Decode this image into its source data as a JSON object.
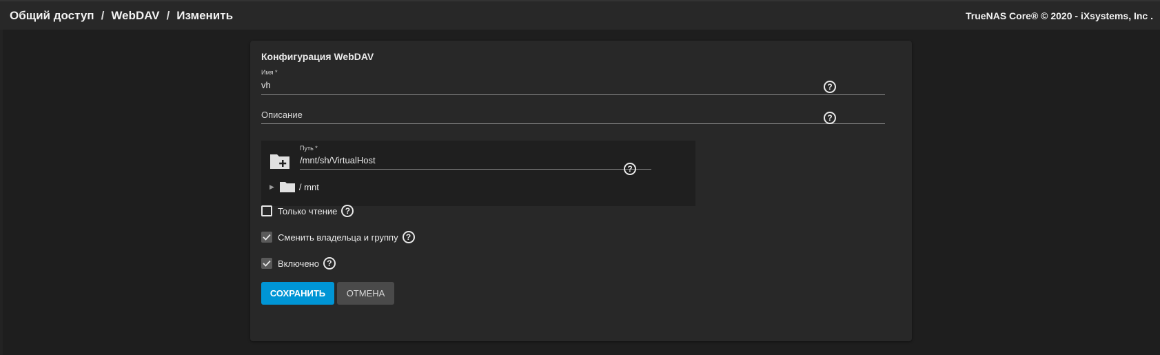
{
  "breadcrumb": {
    "items": [
      "Общий доступ",
      "WebDAV",
      "Изменить"
    ],
    "separator": "/"
  },
  "copyright": "TrueNAS Core® © 2020 - iXsystems, Inc .",
  "form": {
    "title": "Конфигурация WebDAV",
    "name_label": "Имя *",
    "name_value": "vh",
    "description_label": "Описание",
    "path": {
      "label": "Путь *",
      "value": "/mnt/sh/VirtualHost",
      "tree_root": "/ mnt"
    },
    "checkboxes": {
      "readonly": {
        "label": "Только чтение",
        "checked": false
      },
      "change_owner": {
        "label": "Сменить владельца и группу",
        "checked": true
      },
      "enabled": {
        "label": "Включено",
        "checked": true
      }
    },
    "save_label": "СОХРАНИТЬ",
    "cancel_label": "ОТМЕНА"
  },
  "help_glyph": "?",
  "icons": [
    "help-circle-icon",
    "folder-add-icon",
    "folder-icon",
    "caret-right-icon",
    "check-icon"
  ],
  "colors": {
    "accent": "#0095d5",
    "background": "#1e1e1e",
    "card": "#282828",
    "cancel": "#4a4a4a"
  }
}
